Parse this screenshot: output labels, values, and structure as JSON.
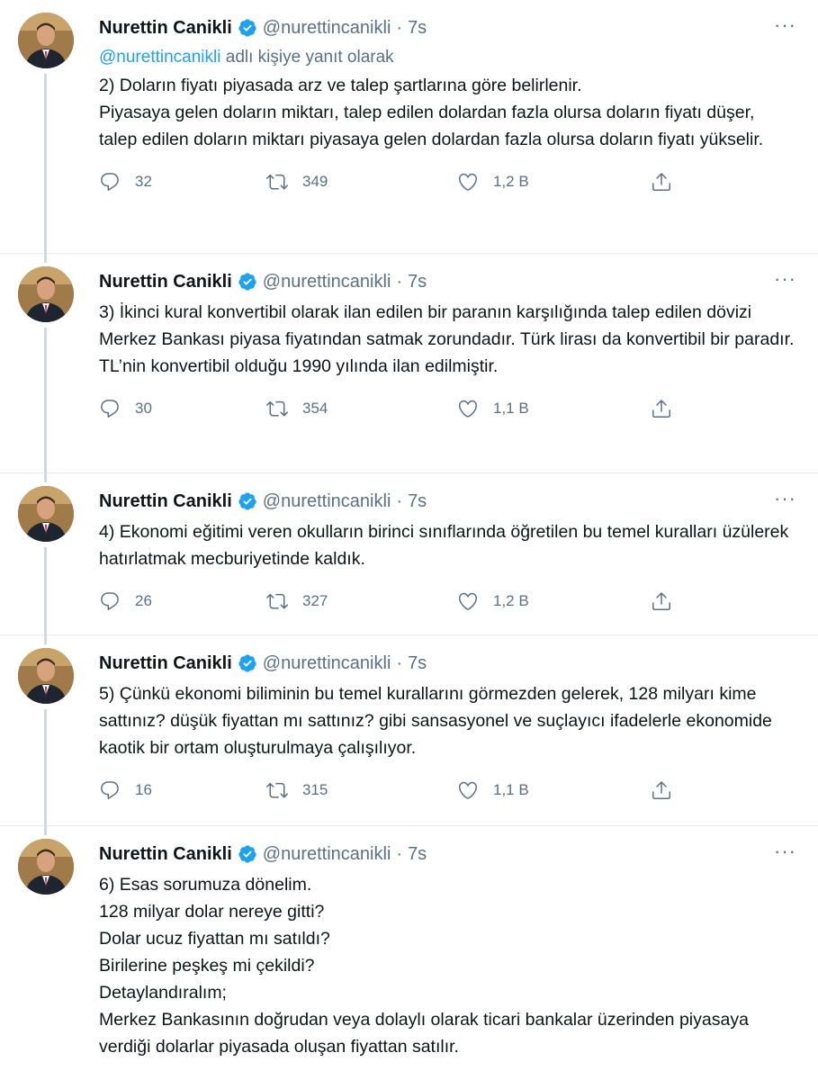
{
  "author": {
    "name": "Nurettin Canikli",
    "handle": "@nurettincanikli",
    "time": "7s",
    "dot": "·"
  },
  "more_label": "···",
  "icons": {
    "verified": "verified-badge-icon",
    "reply": "reply-icon",
    "retweet": "retweet-icon",
    "like": "like-icon",
    "share": "share-icon",
    "more": "more-icon"
  },
  "colors": {
    "accent": "#1da1f2",
    "secondary_text": "#5b7083",
    "primary_text": "#0f1419",
    "thread_line": "#cfd9de"
  },
  "tweets": [
    {
      "reply_to_link": "@nurettincanikli",
      "reply_to_suffix": " adlı kişiye yanıt olarak",
      "text": "2) Doların fiyatı piyasada arz ve talep şartlarına göre belirlenir.\nPiyasaya gelen doların miktarı, talep edilen dolardan fazla olursa doların fiyatı düşer, talep edilen doların miktarı piyasaya gelen dolardan fazla olursa doların fiyatı yükselir.",
      "replies": "32",
      "retweets": "349",
      "likes": "1,2 B"
    },
    {
      "text": "3) İkinci kural konvertibil olarak ilan edilen bir paranın karşılığında talep edilen dövizi Merkez Bankası piyasa fiyatından satmak zorundadır. Türk lirası da konvertibil bir paradır. TL’nin konvertibil olduğu 1990 yılında ilan edilmiştir.",
      "replies": "30",
      "retweets": "354",
      "likes": "1,1 B"
    },
    {
      "text": "4) Ekonomi eğitimi veren okulların birinci sınıflarında öğretilen bu temel kuralları üzülerek hatırlatmak mecburiyetinde kaldık.",
      "replies": "26",
      "retweets": "327",
      "likes": "1,2 B"
    },
    {
      "text": "5) Çünkü ekonomi biliminin bu temel kurallarını görmezden gelerek, 128 milyarı kime sattınız? düşük fiyattan mı sattınız? gibi sansasyonel ve suçlayıcı ifadelerle ekonomide kaotik bir ortam oluşturulmaya çalışılıyor.",
      "replies": "16",
      "retweets": "315",
      "likes": "1,1 B"
    },
    {
      "text": "6) Esas sorumuza dönelim.\n128 milyar dolar nereye gitti?\nDolar ucuz fiyattan mı satıldı?\nBirilerine peşkeş mi çekildi?\nDetaylandıralım;\nMerkez Bankasının doğrudan veya dolaylı olarak ticari bankalar üzerinden piyasaya verdiği dolarlar piyasada oluşan fiyattan satılır."
    }
  ]
}
